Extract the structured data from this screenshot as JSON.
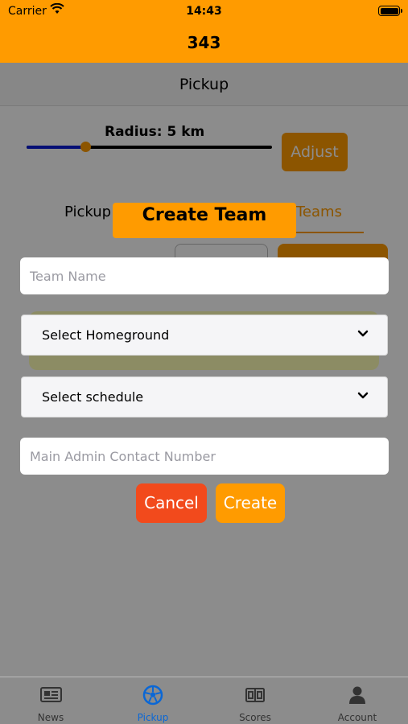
{
  "status_bar": {
    "carrier": "Carrier",
    "time": "14:43"
  },
  "app_header": {
    "title": "343"
  },
  "nav_bar": {
    "title": "Pickup"
  },
  "radius": {
    "label": "Radius: 5 km",
    "slider_fraction": 0.24,
    "adjust_label": "Adjust"
  },
  "segments": {
    "pickup_label": "Pickup",
    "teams_label": "Teams"
  },
  "modal": {
    "title": "Create Team",
    "team_name_placeholder": "Team Name",
    "homeground_label": "Select Homeground",
    "schedule_label": "Select schedule",
    "contact_placeholder": "Main Admin Contact Number",
    "cancel_label": "Cancel",
    "create_label": "Create"
  },
  "tabs": [
    {
      "label": "News",
      "icon": "newspaper-icon"
    },
    {
      "label": "Pickup",
      "icon": "soccer-ball-icon"
    },
    {
      "label": "Scores",
      "icon": "scoreboard-icon"
    },
    {
      "label": "Account",
      "icon": "person-icon"
    }
  ],
  "colors": {
    "accent": "#ff9b00",
    "cancel": "#f24a1c",
    "active_tab": "#0a67d6",
    "slider_fill": "#0a1cd6"
  }
}
